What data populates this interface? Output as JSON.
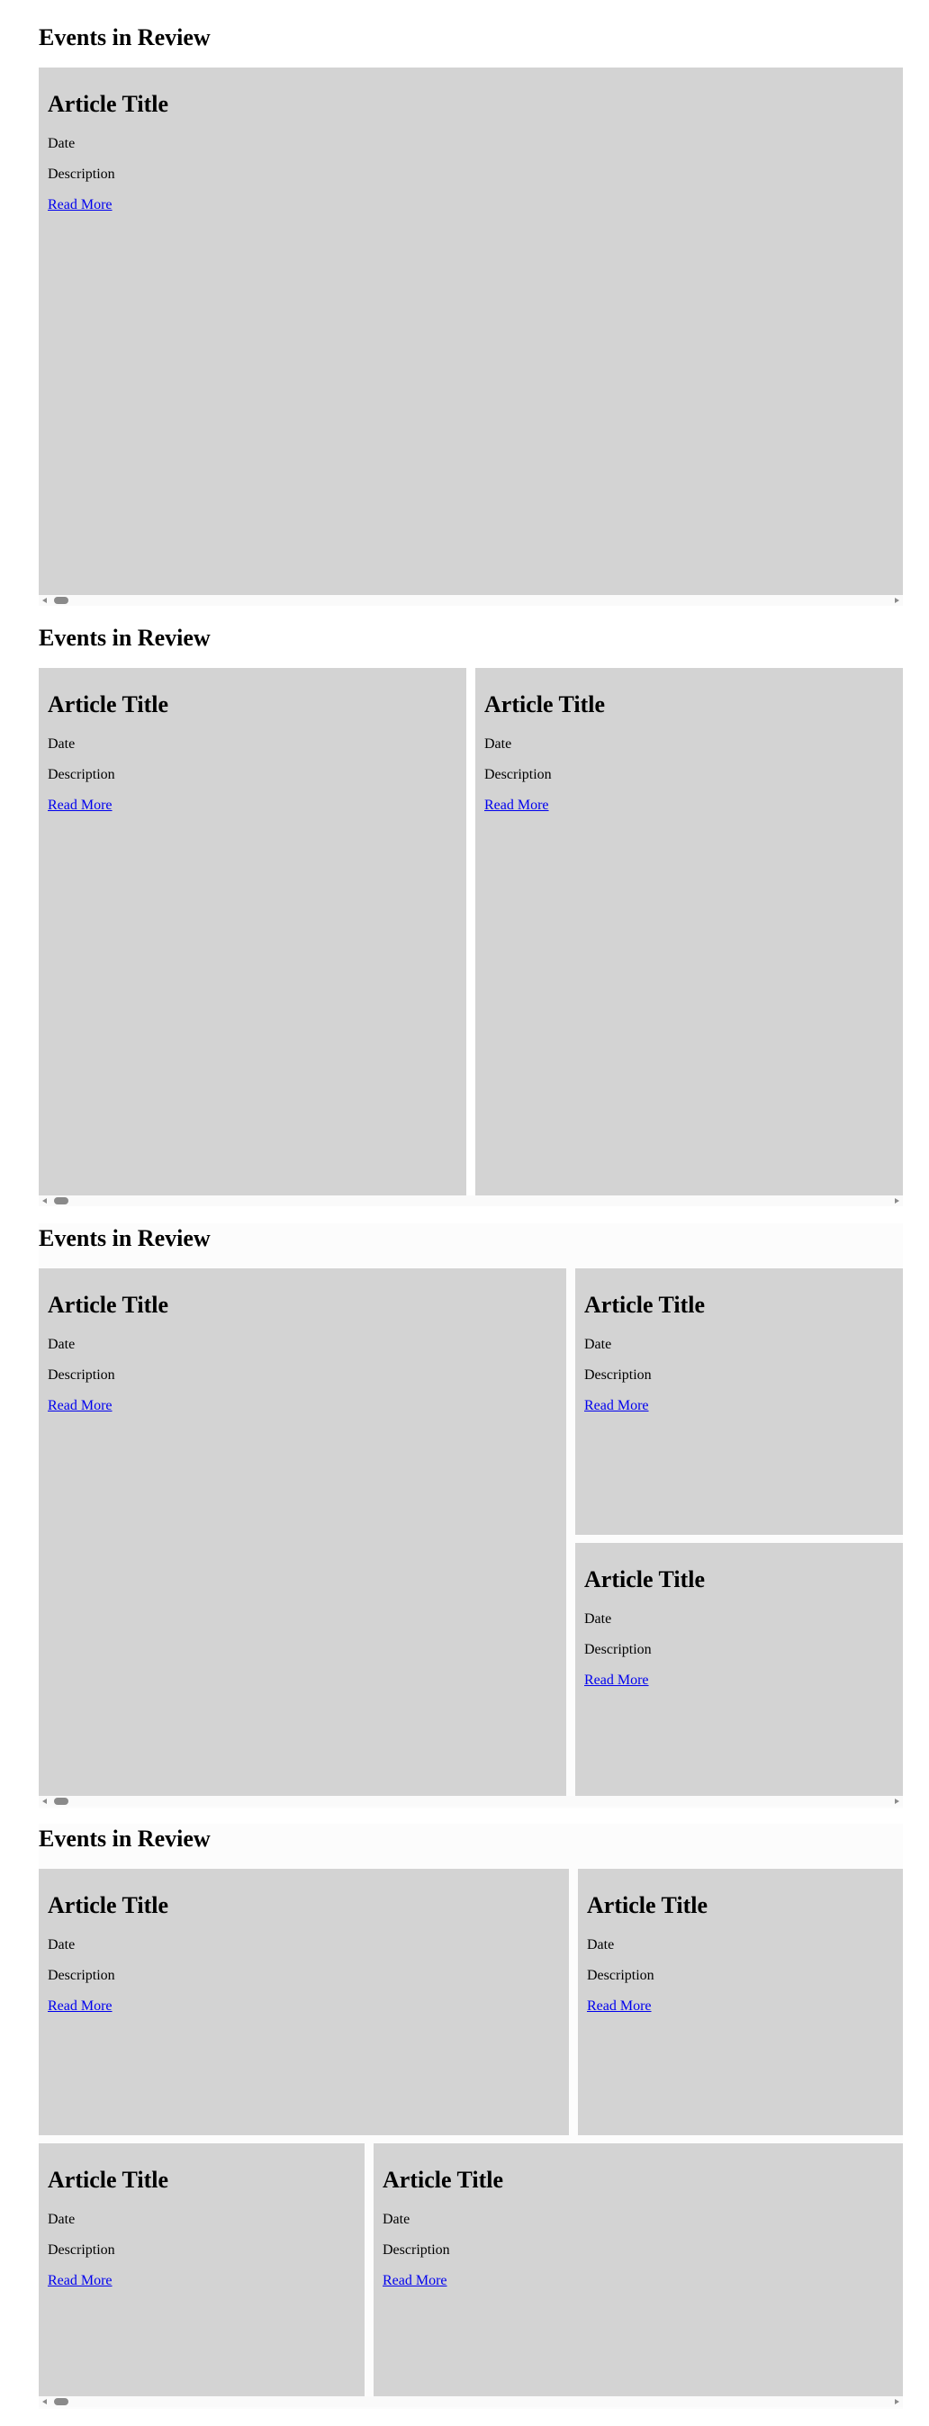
{
  "sections": [
    {
      "title": "Events in Review",
      "cards": [
        {
          "title": "Article Title",
          "date": "Date",
          "description": "Description",
          "link": "Read More"
        }
      ]
    },
    {
      "title": "Events in Review",
      "cards": [
        {
          "title": "Article Title",
          "date": "Date",
          "description": "Description",
          "link": "Read More"
        },
        {
          "title": "Article Title",
          "date": "Date",
          "description": "Description",
          "link": "Read More"
        }
      ]
    },
    {
      "title": "Events in Review",
      "cards": [
        {
          "title": "Article Title",
          "date": "Date",
          "description": "Description",
          "link": "Read More"
        },
        {
          "title": "Article Title",
          "date": "Date",
          "description": "Description",
          "link": "Read More"
        },
        {
          "title": "Article Title",
          "date": "Date",
          "description": "Description",
          "link": "Read More"
        }
      ]
    },
    {
      "title": "Events in Review",
      "cards": [
        {
          "title": "Article Title",
          "date": "Date",
          "description": "Description",
          "link": "Read More"
        },
        {
          "title": "Article Title",
          "date": "Date",
          "description": "Description",
          "link": "Read More"
        },
        {
          "title": "Article Title",
          "date": "Date",
          "description": "Description",
          "link": "Read More"
        },
        {
          "title": "Article Title",
          "date": "Date",
          "description": "Description",
          "link": "Read More"
        }
      ]
    }
  ],
  "colors": {
    "card_background": "#d3d3d3",
    "link": "#0000ee",
    "scrollbar_thumb": "#8a8a8a"
  },
  "icons": [
    "scroll-left-arrow-icon",
    "scroll-right-arrow-icon"
  ]
}
